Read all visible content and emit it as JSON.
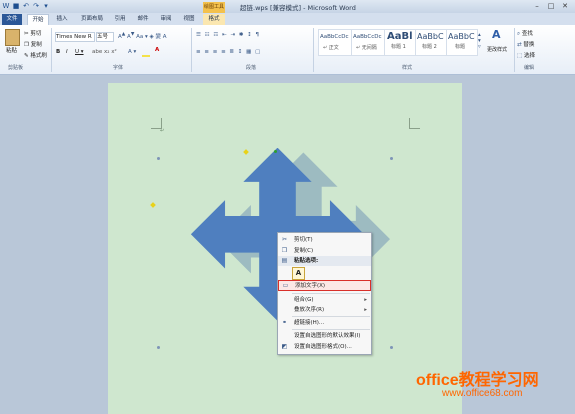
{
  "window": {
    "title": "超链.wps [兼容模式] - Microsoft Word",
    "contextual_tab_group": "绘图工具",
    "controls": [
      "–",
      "□",
      "✕"
    ]
  },
  "tabs": [
    "文件",
    "开始",
    "插入",
    "页面布局",
    "引用",
    "邮件",
    "审阅",
    "视图",
    "格式"
  ],
  "ribbon": {
    "clipboard": {
      "paste": "粘贴",
      "cut": "剪切",
      "copy": "复制",
      "format_painter": "格式刷",
      "group": "剪贴板"
    },
    "font": {
      "name": "Times New R",
      "size": "五号",
      "group": "字体"
    },
    "paragraph": {
      "group": "段落"
    },
    "styles": {
      "items": [
        {
          "preview": "AaBbCcDc",
          "label": "↵ 正文"
        },
        {
          "preview": "AaBbCcDc",
          "label": "↵ 无间隔"
        },
        {
          "preview": "AaBl",
          "label": "标题 1"
        },
        {
          "preview": "AaBbC",
          "label": "标题 2"
        },
        {
          "preview": "AaBbC",
          "label": "标题"
        }
      ],
      "change_styles": "更改样式",
      "group": "样式"
    },
    "editing": {
      "find": "查找",
      "replace": "替换",
      "select": "选择",
      "group": "编辑"
    }
  },
  "context_menu": {
    "items": [
      {
        "icon": "scissors-icon",
        "label": "剪切(T)"
      },
      {
        "icon": "copy-icon",
        "label": "复制(C)"
      },
      {
        "icon": "paste-icon",
        "label": "粘贴选项:"
      },
      {
        "icon": "paste-keep-text-icon",
        "label": "A"
      },
      {
        "icon": "textbox-icon",
        "label": "添加文字(X)"
      },
      {
        "icon": "",
        "label": "组合(G)"
      },
      {
        "icon": "",
        "label": "叠放次序(R)"
      },
      {
        "icon": "hyperlink-icon",
        "label": "超链接(H)..."
      },
      {
        "icon": "",
        "label": "设置自选图形的默认效果(I)"
      },
      {
        "icon": "format-shape-icon",
        "label": "设置自选图形格式(O)..."
      }
    ]
  },
  "watermark": {
    "line1": "office教程学习网",
    "line2": "www.office68.com"
  },
  "colors": {
    "arrow_fill": "#4f7fbf",
    "page_bg": "#cfe7cf",
    "highlight": "#d9302a",
    "watermark": "#ff6600"
  }
}
